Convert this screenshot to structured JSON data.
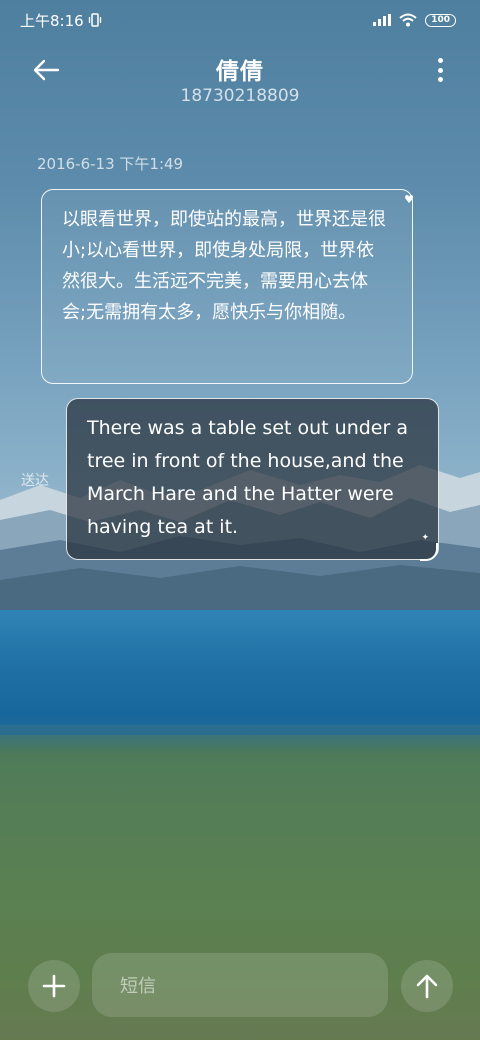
{
  "status_bar": {
    "time": "上午8:16",
    "battery": "100"
  },
  "header": {
    "contact_name": "倩倩",
    "phone_number": "18730218809"
  },
  "conversation": {
    "timestamp": "2016-6-13 下午1:49",
    "messages": [
      {
        "direction": "incoming",
        "text": "以眼看世界，即使站的最高，世界还是很小;以心看世界，即使身处局限，世界依然很大。生活远不完美，需要用心去体会;无需拥有太多，愿快乐与你相随。"
      },
      {
        "direction": "outgoing",
        "text": "There was a table set out under a tree in front of the house,and the March Hare and the Hatter were having tea at it.",
        "status": "送达"
      }
    ]
  },
  "compose": {
    "placeholder": "短信"
  },
  "icons": {
    "back": "arrow-left-icon",
    "more": "more-vertical-icon",
    "add": "plus-icon",
    "send": "arrow-up-icon"
  }
}
